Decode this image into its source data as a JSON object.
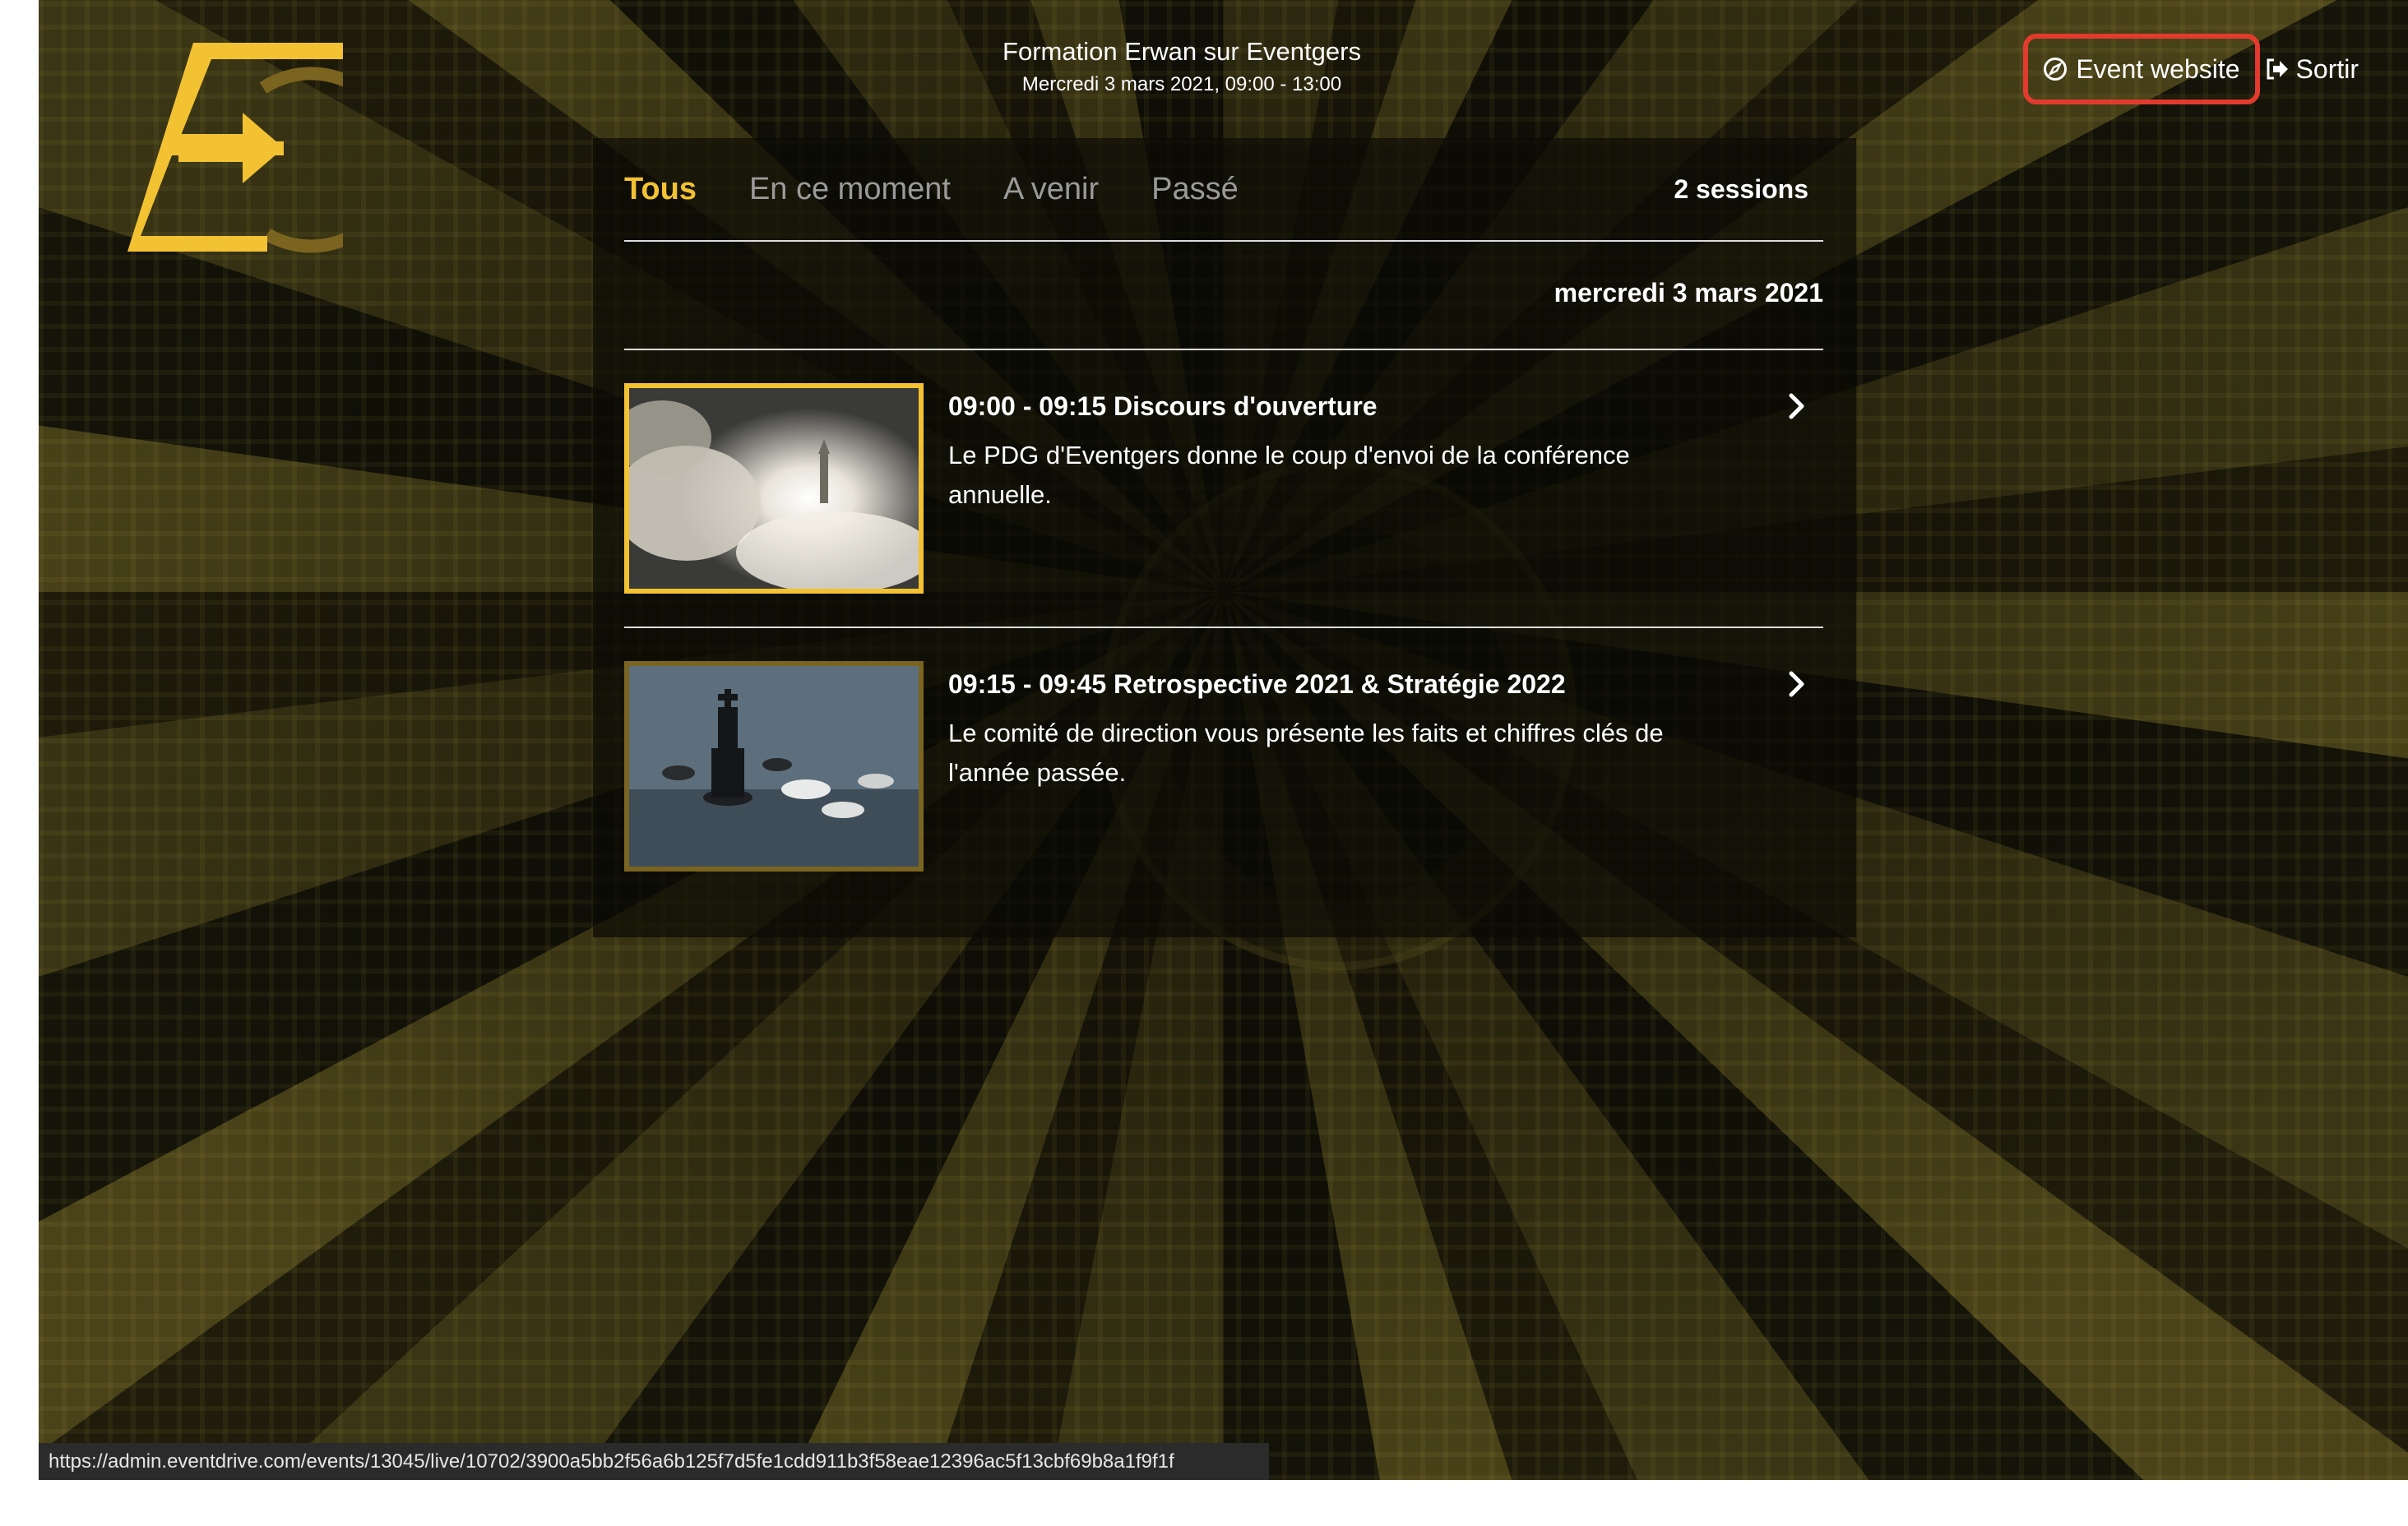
{
  "event": {
    "title": "Formation Erwan sur Eventgers",
    "date": "Mercredi 3 mars 2021, 09:00 - 13:00"
  },
  "header": {
    "event_website_label": "Event website",
    "logout_label": "Sortir"
  },
  "tabs": [
    {
      "label": "Tous",
      "active": true
    },
    {
      "label": "En ce moment",
      "active": false
    },
    {
      "label": "A venir",
      "active": false
    },
    {
      "label": "Passé",
      "active": false
    }
  ],
  "session_count": "2 sessions",
  "date_heading": "mercredi 3 mars 2021",
  "sessions": [
    {
      "title": "09:00 - 09:15 Discours d'ouverture",
      "description": "Le PDG d'Eventgers donne le coup d'envoi de la conférence annuelle.",
      "thumbnail": "rocket-launch-image"
    },
    {
      "title": "09:15 - 09:45 Retrospective 2021 & Stratégie 2022",
      "description": "Le comité de direction vous présente les faits et chiffres clés de l'année passée.",
      "thumbnail": "chess-king-image"
    }
  ],
  "status_url": "https://admin.eventdrive.com/events/13045/live/10702/3900a5bb2f56a6b125f7d5fe1cdd911b3f58eae12396ac5f13cbf69b8a1f9f1f",
  "colors": {
    "accent": "#f3c233",
    "highlight": "#e23b2e"
  }
}
